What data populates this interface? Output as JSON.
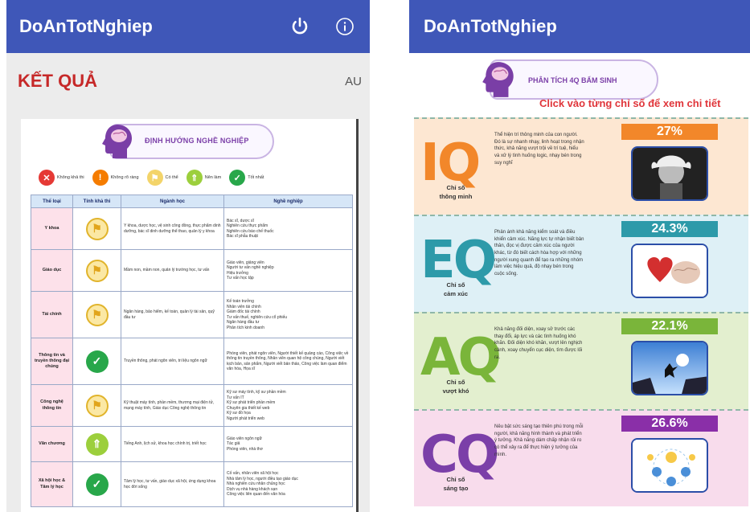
{
  "app_title": "DoAnTotNghiep",
  "left": {
    "result_title": "KẾT QUẢ",
    "result_code": "AU",
    "banner": "ĐỊNH HƯỚNG NGHỀ NGHIỆP",
    "legend": [
      {
        "label": "Không khả thi",
        "color": "#e53935",
        "symbol": "✕"
      },
      {
        "label": "Không rõ ràng",
        "color": "#f57c00",
        "symbol": "!"
      },
      {
        "label": "Có thể",
        "color": "#f3d46a",
        "symbol": "⚑"
      },
      {
        "label": "Nên làm",
        "color": "#9ccf3c",
        "symbol": "⇑"
      },
      {
        "label": "Tốt nhất",
        "color": "#28a74a",
        "symbol": "✓"
      }
    ],
    "table_headers": [
      "Thể loại",
      "Tính khả thi",
      "Ngành học",
      "Nghề nghiệp"
    ],
    "rows": [
      {
        "group": "Y khoa",
        "status": "maybe",
        "majors": "Y khoa, dược học, vệ sinh công đồng, thực phẩm dinh dưỡng, bác sĩ dinh dưỡng thể thao, quản lý y khoa",
        "careers": "Bác sĩ, dược sĩ\nNghiên cứu thực phẩm\nNghiên cứu bào chế thuốc\nBác sĩ phẫu thuật"
      },
      {
        "group": "Giáo dục",
        "status": "maybe",
        "majors": "Mầm non, mầm non, quản lý trường học, tư vấn",
        "careers": "Giáo viên, giảng viên\nNgười tư vấn nghề nghiệp\nHiệu trưởng\nTư vấn học tập"
      },
      {
        "group": "Tài chính",
        "status": "maybe",
        "majors": "Ngân hàng, bảo hiểm, kế toán, quản lý tài sản, quỹ đầu tư",
        "careers": "Kế toán trưởng\nNhân viên tài chính\nGiám đốc tài chính\nTư vấn thuế, nghiên cứu cổ phiếu\nNgân hàng đầu tư\nPhân tích kinh doanh"
      },
      {
        "group": "Thông tin và truyền thông đại chúng",
        "status": "best",
        "majors": "Truyền thông, phát ngôn viên, tri liệu ngôn ngữ",
        "careers": "Phóng viên, phát ngôn viên, Người thiết kế quảng cáo, Công việc về thông tin truyền thông, Nhân viên quan hệ công chúng, Người viết kịch bản, sản phẩm, Người viết bản thảo, Công việc làm quan điểm văn hóa, Họa sĩ"
      },
      {
        "group": "Công nghệ thông tin",
        "status": "maybe",
        "majors": "Kỹ thuật máy tính, phần mềm, thương mại điện tử, mạng máy tính, Giáo dục Công nghệ thông tin",
        "careers": "Kỹ sư máy tính, kỹ sư phần mềm\nTư vấn IT\nKỹ sư phát triển phần mềm\nChuyên gia thiết kế web\nKỹ sư đồ họa\nNgười phát triển web"
      },
      {
        "group": "Văn chương",
        "status": "good",
        "majors": "Tiếng Anh, lịch sử, khoa học chính trị, triết học",
        "careers": "Giáo viên ngôn ngữ\nTác giả\nPhóng viên, nhà thơ"
      },
      {
        "group": "Xã hội học & Tâm lý học",
        "status": "best",
        "majors": "Tâm lý học, tư vấn, giáo dục xã hội, ứng dụng khoa học đời sống",
        "careers": "Cố vấn, nhân viên xã hội học\nNhà tâm lý học, người điều tạo giáo dục\nNhà nghiên cứu nhân chủng học\nDịch vụ nhà hàng khách sạn\nCông việc liên quan đến văn hóa"
      }
    ]
  },
  "right": {
    "banner": "PHÂN TÍCH 4Q BẨM SINH",
    "hint": "Click vào từng chỉ số để xem chi tiết",
    "sections": [
      {
        "code": "IQ",
        "sub1": "Chỉ số",
        "sub2": "thông minh",
        "percent": "27%",
        "bg": "#fde7d2",
        "color": "#f2872a",
        "pct_color": "#f2872a",
        "desc": "Thể hiện trí thông minh của con người. Đó là sự nhanh nhạy, linh hoạt trong nhận thức, khả năng vượt trội về trí tuệ, hiểu và xử lý tình huống logic, nhạy bén trong suy nghĩ"
      },
      {
        "code": "EQ",
        "sub1": "Chỉ số",
        "sub2": "cảm xúc",
        "percent": "24.3%",
        "bg": "#def0f6",
        "color": "#2d9aa9",
        "pct_color": "#2d9aa9",
        "desc": "Phản ánh khả năng kiểm soát và điều khiển cảm xúc. Năng lực tự nhận biết bản thân, đọc vị được cảm xúc của người khác, từ đó biết cách hòa hợp với những người xung quanh để tạo ra những nhóm làm việc hiệu quả, độ nhạy bén trong cuộc sống."
      },
      {
        "code": "AQ",
        "sub1": "Chỉ số",
        "sub2": "vượt khó",
        "percent": "22.1%",
        "bg": "#e3efcf",
        "color": "#7ab53a",
        "pct_color": "#7ab53a",
        "desc": "Khả năng đối diện, xoay sở trước các thay đổi, áp lực và các tình huống khó khăn. Đối diện khó khăn, vượt lên nghịch cảnh, xoay chuyển cục diện, tìm được lối ra."
      },
      {
        "code": "CQ",
        "sub1": "Chỉ số",
        "sub2": "sáng tạo",
        "percent": "26.6%",
        "bg": "#f8dcec",
        "color": "#7b3fa8",
        "pct_color": "#8a2fa8",
        "desc": "Nêu bật sức sáng tạo thiên phú trong mỗi người, khả năng hình thành và phát triển ý tưởng. Khả năng dám chấp nhận rủi ro có thể xảy ra để thực hiện ý tưởng của mình."
      }
    ]
  }
}
